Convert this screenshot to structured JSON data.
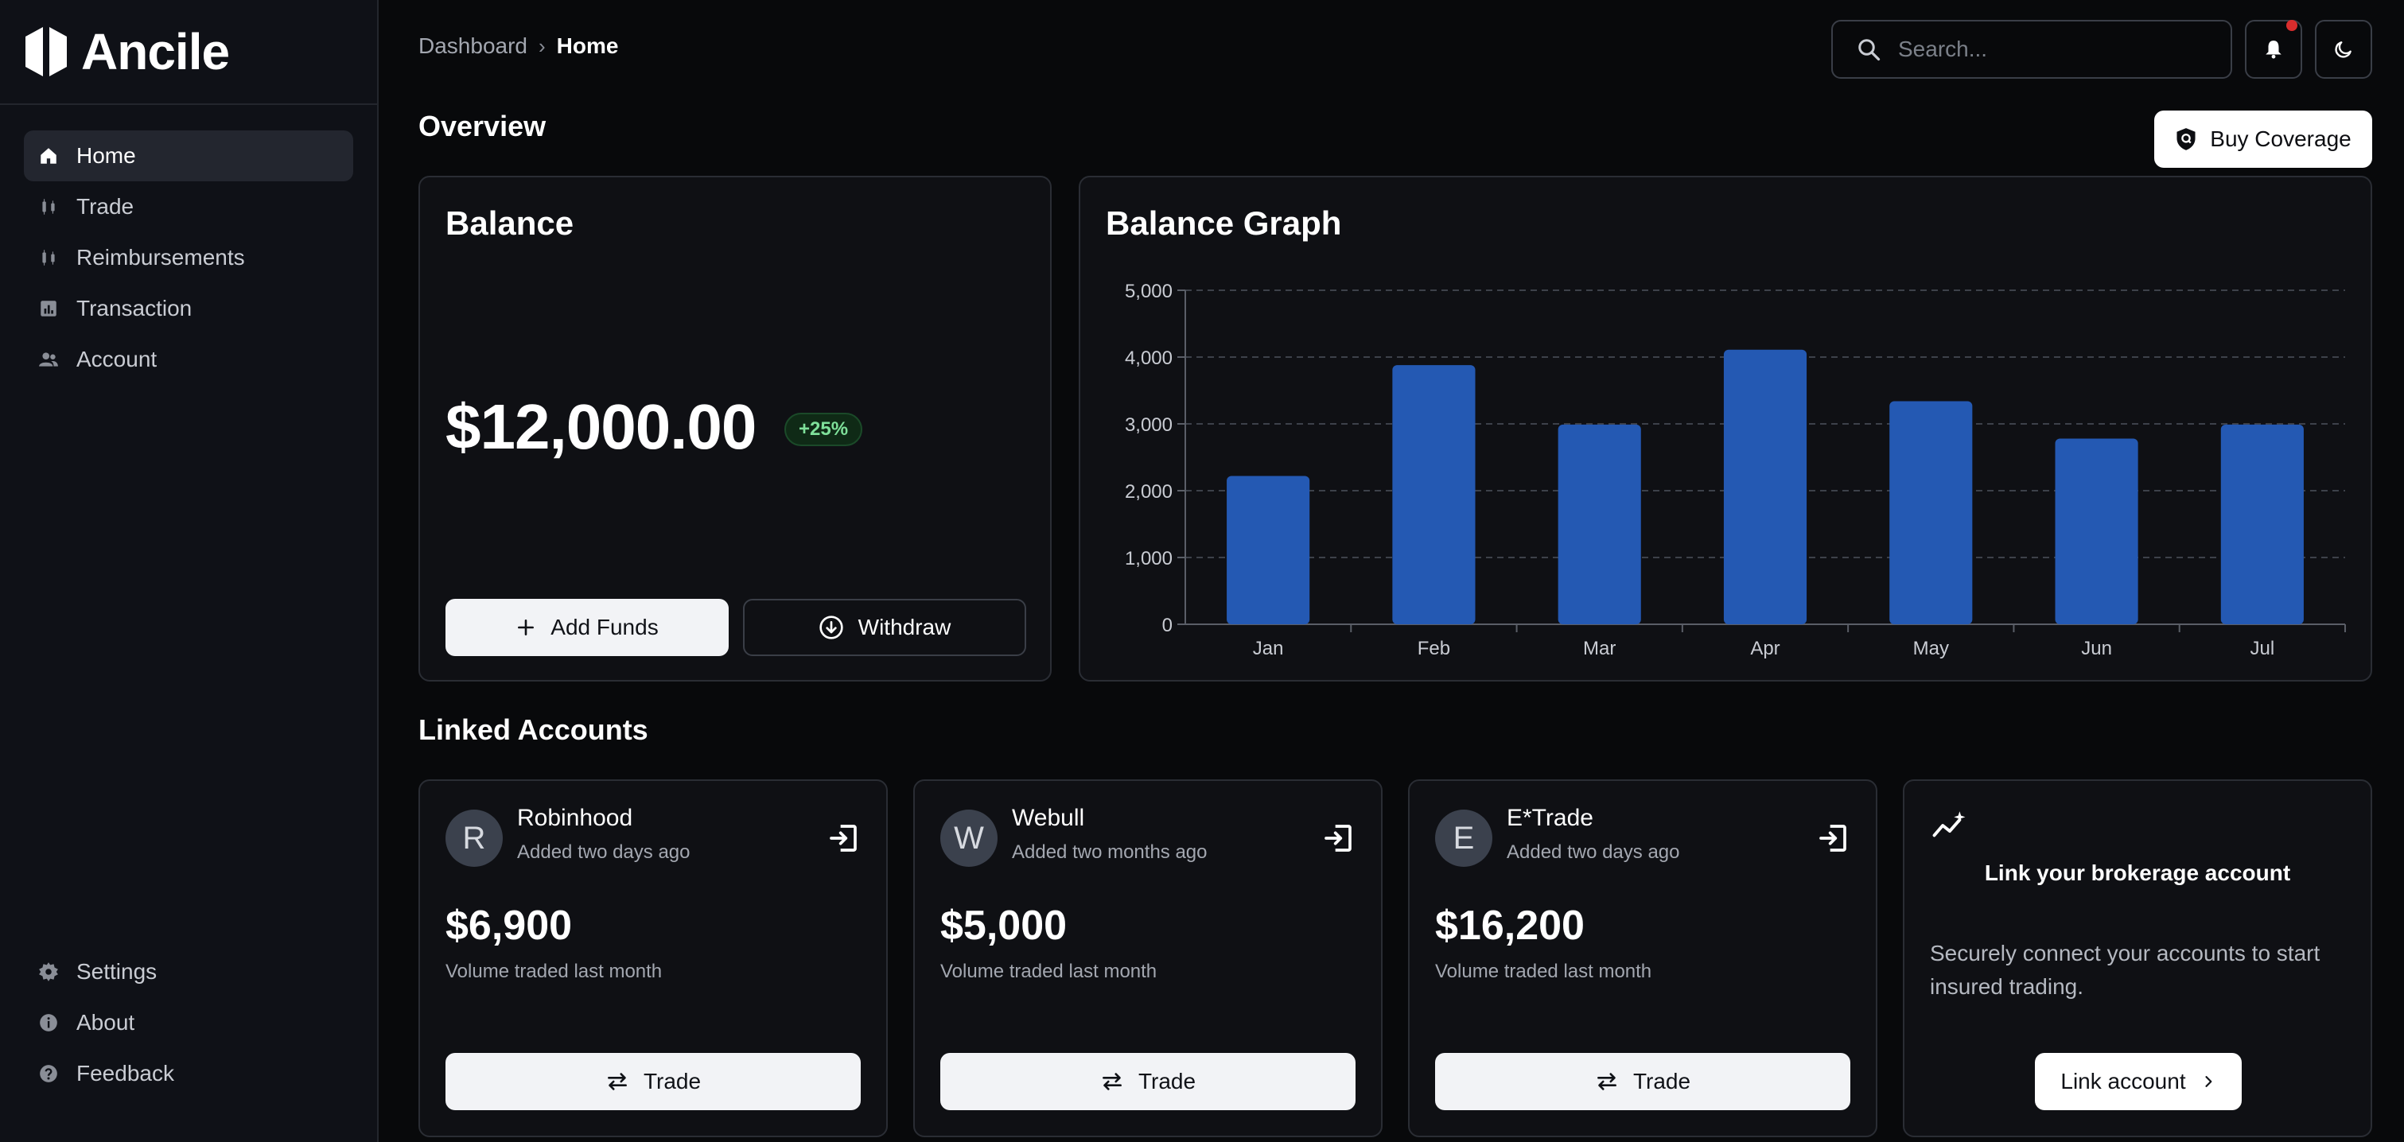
{
  "app": {
    "name": "Ancile"
  },
  "sidebar": {
    "items": [
      {
        "label": "Home",
        "icon": "home-icon",
        "active": true
      },
      {
        "label": "Trade",
        "icon": "candlestick-icon",
        "active": false
      },
      {
        "label": "Reimbursements",
        "icon": "candlestick-icon",
        "active": false
      },
      {
        "label": "Transaction",
        "icon": "bar-chart-icon",
        "active": false
      },
      {
        "label": "Account",
        "icon": "users-icon",
        "active": false
      }
    ],
    "bottom_items": [
      {
        "label": "Settings",
        "icon": "gear-icon"
      },
      {
        "label": "About",
        "icon": "info-icon"
      },
      {
        "label": "Feedback",
        "icon": "help-icon"
      }
    ]
  },
  "header": {
    "breadcrumb": [
      "Dashboard",
      "Home"
    ],
    "search_placeholder": "Search...",
    "notification_dot_color": "#d92d2d"
  },
  "overview": {
    "title": "Overview",
    "buy_coverage_label": "Buy Coverage",
    "balance": {
      "title": "Balance",
      "amount": "$12,000.00",
      "change": "+25%",
      "add_funds_label": "Add Funds",
      "withdraw_label": "Withdraw"
    },
    "graph": {
      "title": "Balance Graph"
    }
  },
  "chart_data": {
    "type": "bar",
    "title": "Balance Graph",
    "categories": [
      "Jan",
      "Feb",
      "Mar",
      "Apr",
      "May",
      "Jun",
      "Jul"
    ],
    "values": [
      2220,
      3880,
      2990,
      4110,
      3340,
      2780,
      2990
    ],
    "ylim": [
      0,
      5000
    ],
    "yticks": [
      0,
      1000,
      2000,
      3000,
      4000,
      5000
    ],
    "ytick_labels": [
      "0",
      "1,000",
      "2,000",
      "3,000",
      "4,000",
      "5,000"
    ],
    "grid": true,
    "bar_color": "#2459b3"
  },
  "linked_accounts": {
    "title": "Linked Accounts",
    "accounts": [
      {
        "initial": "R",
        "name": "Robinhood",
        "added": "Added two days ago",
        "volume": "$6,900",
        "caption": "Volume traded last month",
        "trade_label": "Trade"
      },
      {
        "initial": "W",
        "name": "Webull",
        "added": "Added two months ago",
        "volume": "$5,000",
        "caption": "Volume traded last month",
        "trade_label": "Trade"
      },
      {
        "initial": "E",
        "name": "E*Trade",
        "added": "Added two days ago",
        "volume": "$16,200",
        "caption": "Volume traded last month",
        "trade_label": "Trade"
      }
    ],
    "link_card": {
      "title": "Link your brokerage account",
      "description": "Securely connect your accounts to start insured trading.",
      "button_label": "Link account"
    }
  }
}
